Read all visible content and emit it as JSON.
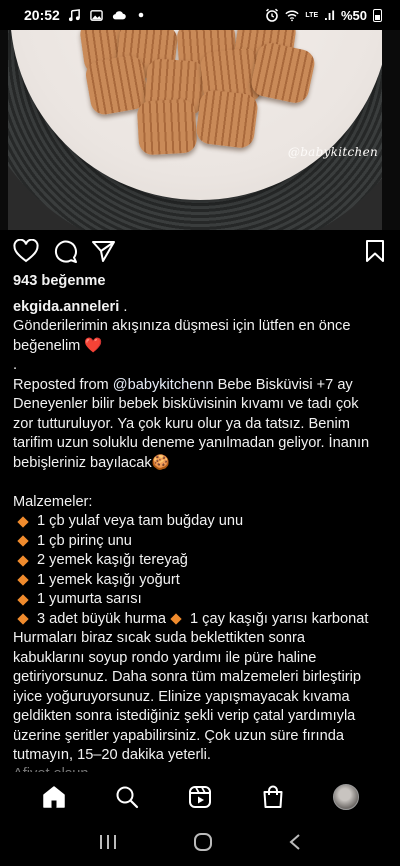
{
  "status_bar": {
    "time": "20:52",
    "lte_label": "LTE",
    "signal_text": ".ıl",
    "battery_percent": "%50"
  },
  "post": {
    "image_watermark": "@babykitchen",
    "likes": "943 beğenme",
    "username": "ekgida.anneleri",
    "caption_lines": [
      "Gönderilerimin akışınıza düşmesi için lütfen en önce",
      "beğenelim ❤️",
      "."
    ],
    "repost_prefix": "Reposted from ",
    "repost_handle": "@babykitchenn",
    "repost_suffix": " Bebe Bisküvisi +7 ay",
    "body_lines": [
      "Deneyenler bilir bebek bisküvisinin kıvamı ve tadı çok",
      "zor tutturuluyor. Ya çok kuru olur ya da tatsız. Benim",
      "tarifim uzun soluklu deneme yanılmadan geliyor. İnanın",
      "bebişleriniz bayılacak🍪"
    ],
    "ingredients_title": "Malzemeler:",
    "ingredients": [
      "1 çb yulaf veya tam buğday unu",
      "1 çb pirinç unu",
      "2 yemek kaşığı tereyağ",
      "1 yemek kaşığı yoğurt",
      "1 yumurta sarısı"
    ],
    "ingredient_last_a": "3 adet büyük hurma",
    "ingredient_last_b": "1 çay kaşığı yarısı karbonat",
    "instructions_lines": [
      "Hurmaları biraz sıcak suda beklettikten sonra",
      "kabuklarını soyup rondo yardımı ile püre haline",
      "getiriyorsunuz. Daha sonra tüm malzemeleri birleştirip",
      "iyice yoğuruyorsunuz. Elinize yapışmayacak kıvama",
      "geldikten sonra istediğiniz şekli verip çatal yardımıyla",
      "üzerine şeritler yapabilirsiniz. Çok uzun süre fırında",
      "tutmayın, 15–20 dakika yeterli."
    ],
    "cut_off_line": "Afiyet olsun"
  },
  "icons": {
    "like": "heart-icon",
    "comment": "comment-icon",
    "share": "send-icon",
    "save": "bookmark-icon",
    "nav_home": "home-icon",
    "nav_search": "search-icon",
    "nav_reels": "reels-icon",
    "nav_shop": "shop-icon"
  },
  "colors": {
    "background": "#000000",
    "text": "#f2f2f2",
    "heart": "#e0245e",
    "bullet": "#f08b2d"
  }
}
